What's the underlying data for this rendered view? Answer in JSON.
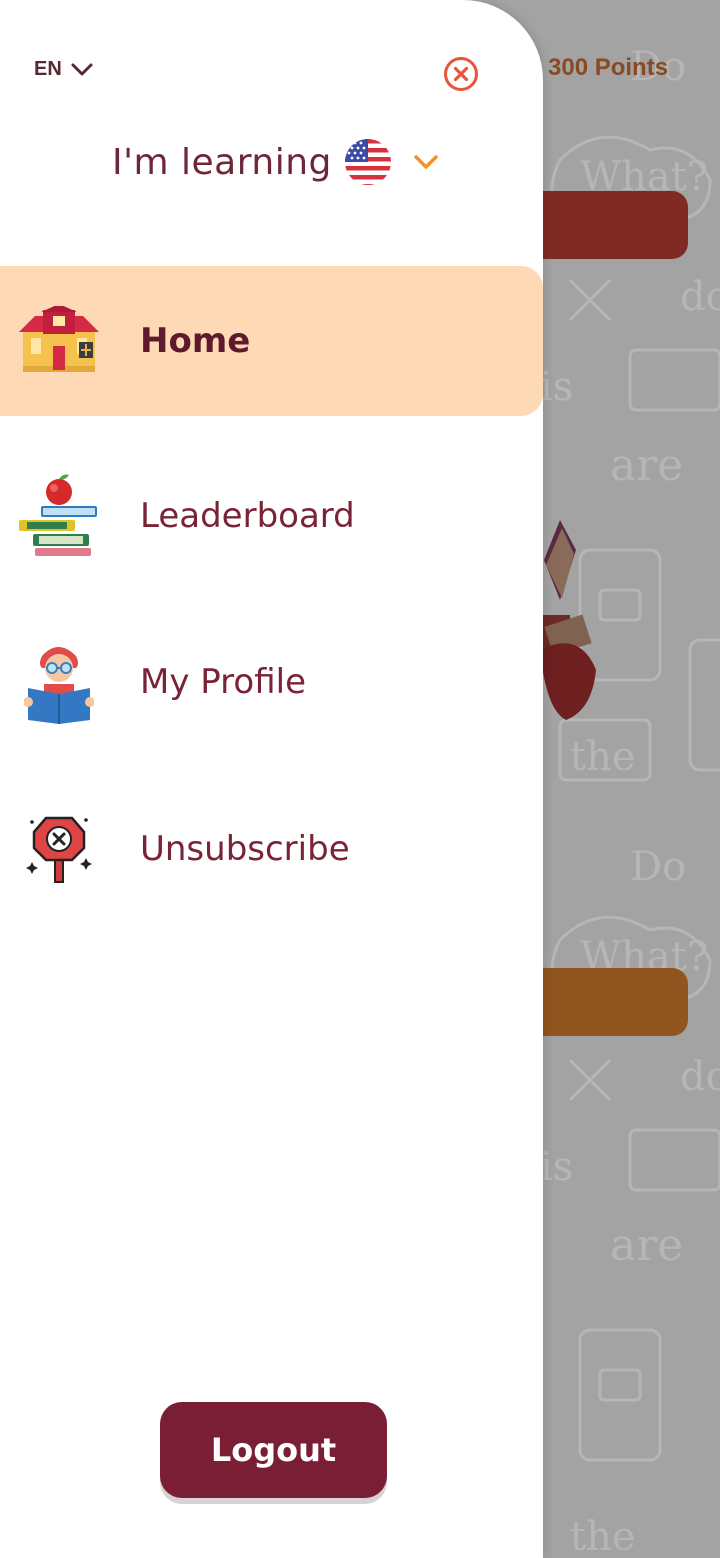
{
  "background": {
    "points_label": "300 Points"
  },
  "drawer": {
    "language_code": "EN",
    "learning_label": "I'm learning",
    "menu": [
      {
        "label": "Home",
        "icon": "school-building-icon",
        "active": true
      },
      {
        "label": "Leaderboard",
        "icon": "books-apple-icon",
        "active": false
      },
      {
        "label": "My Profile",
        "icon": "reader-avatar-icon",
        "active": false
      },
      {
        "label": "Unsubscribe",
        "icon": "stop-sign-icon",
        "active": false
      }
    ],
    "logout_label": "Logout"
  },
  "colors": {
    "accent": "#7a1e35",
    "active_item_bg": "#fdd9b5",
    "close_icon": "#e8553a",
    "chevron_orange": "#f4922a"
  }
}
